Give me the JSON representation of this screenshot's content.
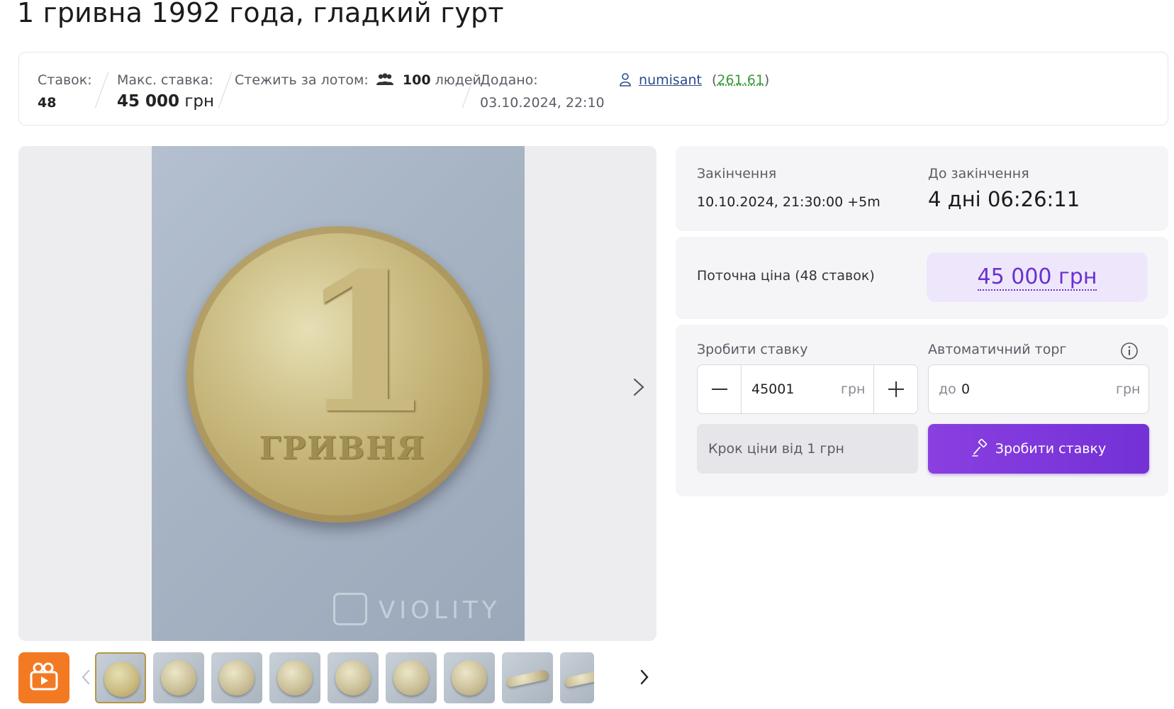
{
  "title": "1 гривна 1992 года, гладкий гурт",
  "stats": {
    "bids_label": "Ставок:",
    "bids_value": "48",
    "max_bid_label": "Макс. ставка:",
    "max_bid_value": "45 000",
    "max_bid_unit": "грн",
    "watch_label": "Стежить за лотом:",
    "watch_count": "100",
    "watch_unit": "людей",
    "added_label": "Додано:",
    "added_value": "03.10.2024, 22:10",
    "seller_name": "numisant",
    "seller_rating": "261.61",
    "seller_rating_open": "(",
    "seller_rating_close": ")"
  },
  "gallery": {
    "coin_numeral": "1",
    "coin_word": "ГРИВНЯ",
    "watermark": "VIOLITY",
    "thumbnail_count": 9,
    "active_thumbnail": 1
  },
  "auction": {
    "end_label": "Закінчення",
    "end_value": "10.10.2024, 21:30:00 +5m",
    "remaining_label": "До закінчення",
    "remaining_value": "4 дні 06:26:11",
    "current_price_label": "Поточна ціна (48 ставок)",
    "current_price_value": "45 000 грн"
  },
  "bid": {
    "make_bid_label": "Зробити ставку",
    "bid_amount": "45001",
    "bid_unit": "грн",
    "auto_label": "Автоматичний торг",
    "auto_prefix": "до",
    "auto_value": "0",
    "auto_unit": "грн",
    "step_note": "Крок ціни від 1 грн",
    "submit_label": "Зробити ставку"
  },
  "colors": {
    "accent": "#7331d6",
    "price_bg": "#eee7fb",
    "video_button": "#f37a23",
    "rating": "#3a9a3a"
  },
  "icons": [
    "people-icon",
    "user-icon",
    "chevron-right-icon",
    "chevron-left-icon",
    "video-icon",
    "gavel-icon",
    "info-icon",
    "minus-icon",
    "plus-icon",
    "crown-icon"
  ]
}
